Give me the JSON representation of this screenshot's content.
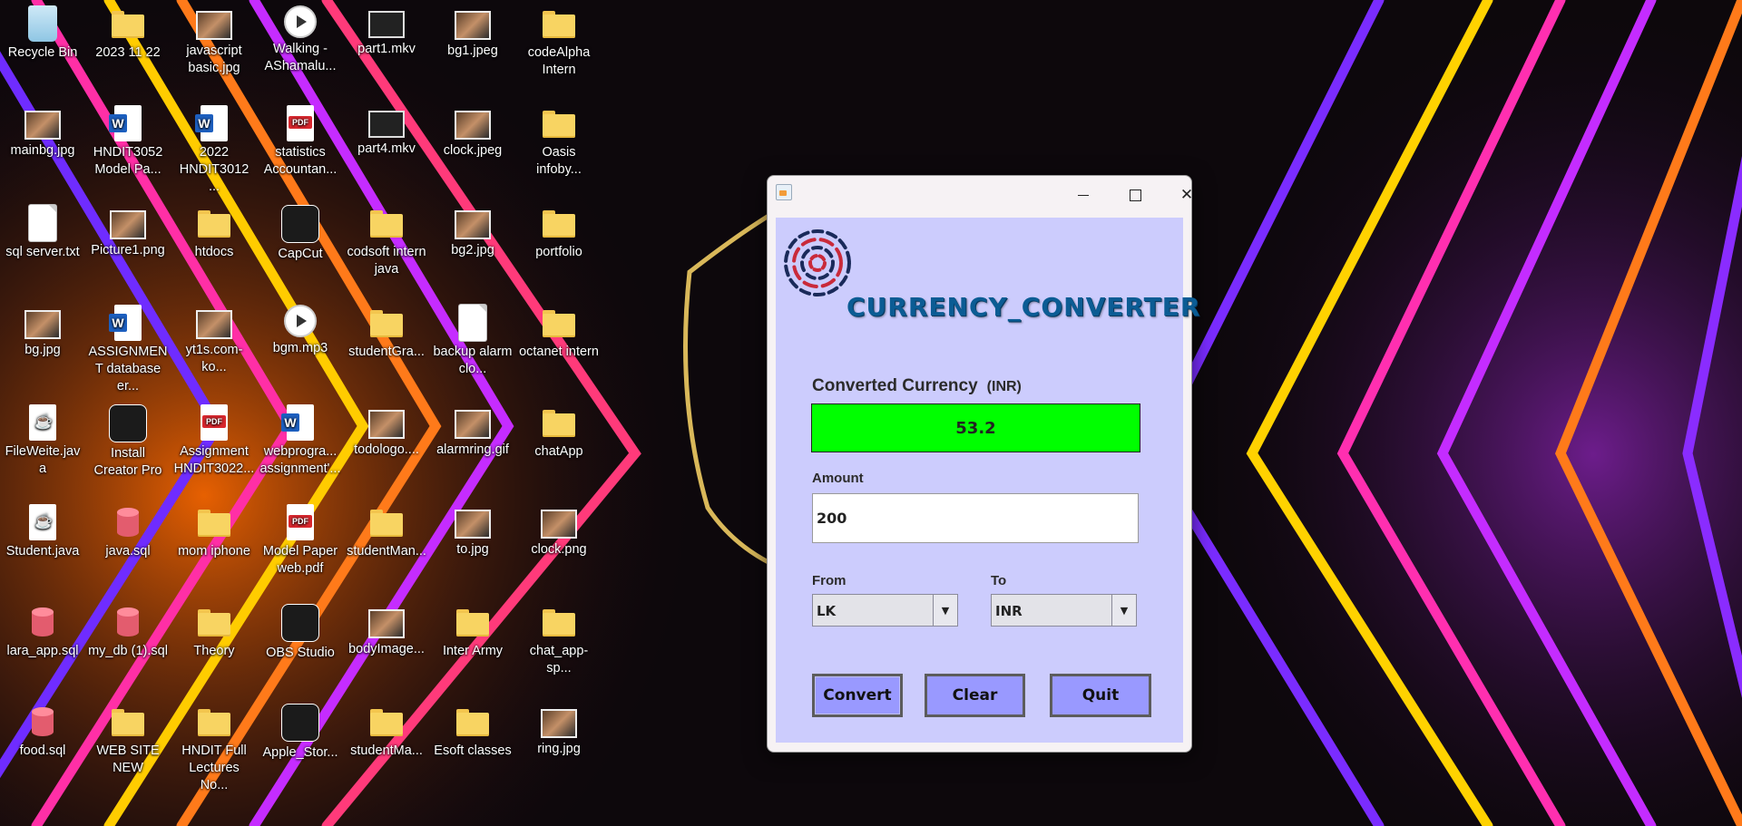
{
  "desktop": {
    "icons": [
      {
        "label": "Recycle Bin",
        "icon": "recycle-bin-icon"
      },
      {
        "label": "2023 11 22",
        "icon": "folder-icon"
      },
      {
        "label": "javascript basic.jpg",
        "icon": "image-file-icon"
      },
      {
        "label": "Walking - AShamalu...",
        "icon": "media-file-icon"
      },
      {
        "label": "part1.mkv",
        "icon": "video-file-icon"
      },
      {
        "label": "bg1.jpeg",
        "icon": "image-file-icon"
      },
      {
        "label": "codeAlpha Intern",
        "icon": "folder-icon"
      },
      {
        "label": "mainbg.jpg",
        "icon": "image-file-icon"
      },
      {
        "label": "HNDIT3052 Model Pa...",
        "icon": "word-document-icon"
      },
      {
        "label": "2022 HNDIT3012 ...",
        "icon": "word-document-icon"
      },
      {
        "label": "statistics Accountan...",
        "icon": "pdf-file-icon"
      },
      {
        "label": "part4.mkv",
        "icon": "video-file-icon"
      },
      {
        "label": "clock.jpeg",
        "icon": "image-file-icon"
      },
      {
        "label": "Oasis infoby...",
        "icon": "folder-icon"
      },
      {
        "label": "sql server.txt",
        "icon": "text-file-icon"
      },
      {
        "label": "Picture1.png",
        "icon": "image-file-icon"
      },
      {
        "label": "htdocs",
        "icon": "folder-icon"
      },
      {
        "label": "CapCut",
        "icon": "capcut-app-icon"
      },
      {
        "label": "codsoft intern java",
        "icon": "folder-icon"
      },
      {
        "label": "bg2.jpg",
        "icon": "image-file-icon"
      },
      {
        "label": "portfolio",
        "icon": "folder-icon"
      },
      {
        "label": "bg.jpg",
        "icon": "image-file-icon"
      },
      {
        "label": "ASSIGNMENT database er...",
        "icon": "word-document-icon"
      },
      {
        "label": "yt1s.com-ko...",
        "icon": "image-file-icon"
      },
      {
        "label": "bgm.mp3",
        "icon": "media-file-icon"
      },
      {
        "label": "studentGra...",
        "icon": "folder-icon"
      },
      {
        "label": "backup alarm clo...",
        "icon": "text-file-icon"
      },
      {
        "label": "octanet intern",
        "icon": "folder-icon"
      },
      {
        "label": "FileWeite.java",
        "icon": "java-file-icon"
      },
      {
        "label": "Install Creator Pro",
        "icon": "installer-app-icon"
      },
      {
        "label": "Assignment HNDIT3022...",
        "icon": "pdf-file-icon"
      },
      {
        "label": "webprogra... assignment'...",
        "icon": "word-document-icon"
      },
      {
        "label": "todologo....",
        "icon": "image-file-icon"
      },
      {
        "label": "alarmring.gif",
        "icon": "image-file-icon"
      },
      {
        "label": "chatApp",
        "icon": "folder-icon"
      },
      {
        "label": "Student.java",
        "icon": "java-file-icon"
      },
      {
        "label": "java.sql",
        "icon": "sql-file-icon"
      },
      {
        "label": "mom iphone",
        "icon": "folder-icon"
      },
      {
        "label": "Model Paper web.pdf",
        "icon": "pdf-file-icon"
      },
      {
        "label": "studentMan...",
        "icon": "folder-icon"
      },
      {
        "label": "to.jpg",
        "icon": "image-file-icon"
      },
      {
        "label": "clock.png",
        "icon": "image-file-icon"
      },
      {
        "label": "lara_app.sql",
        "icon": "sql-file-icon"
      },
      {
        "label": "my_db (1).sql",
        "icon": "sql-file-icon"
      },
      {
        "label": "Theory",
        "icon": "folder-icon"
      },
      {
        "label": "OBS Studio",
        "icon": "obs-app-icon"
      },
      {
        "label": "bodyImage...",
        "icon": "image-file-icon"
      },
      {
        "label": "Inter Army",
        "icon": "folder-icon"
      },
      {
        "label": "chat_app-sp...",
        "icon": "folder-icon"
      },
      {
        "label": "food.sql",
        "icon": "sql-file-icon"
      },
      {
        "label": "WEB SITE NEW",
        "icon": "folder-icon"
      },
      {
        "label": "HNDIT Full Lectures No...",
        "icon": "folder-icon"
      },
      {
        "label": "Apple_Stor...",
        "icon": "apple-store-app-icon"
      },
      {
        "label": "studentMa...",
        "icon": "folder-icon"
      },
      {
        "label": "Esoft classes",
        "icon": "folder-icon"
      },
      {
        "label": "ring.jpg",
        "icon": "image-file-icon"
      }
    ]
  },
  "window": {
    "app_title": "CURRENCY_CONVERTER",
    "converted_label": "Converted Currency",
    "converted_unit": "(INR)",
    "converted_value": "53.2",
    "amount_label": "Amount",
    "amount_value": "200",
    "from_label": "From",
    "from_value": "LK",
    "to_label": "To",
    "to_value": "INR",
    "convert_label": "Convert",
    "clear_label": "Clear",
    "quit_label": "Quit",
    "colors": {
      "content_bg": "#ccccfd",
      "result_bg": "#00ff00",
      "button_bg": "#9999ff",
      "title_color": "#0b5c94"
    }
  }
}
